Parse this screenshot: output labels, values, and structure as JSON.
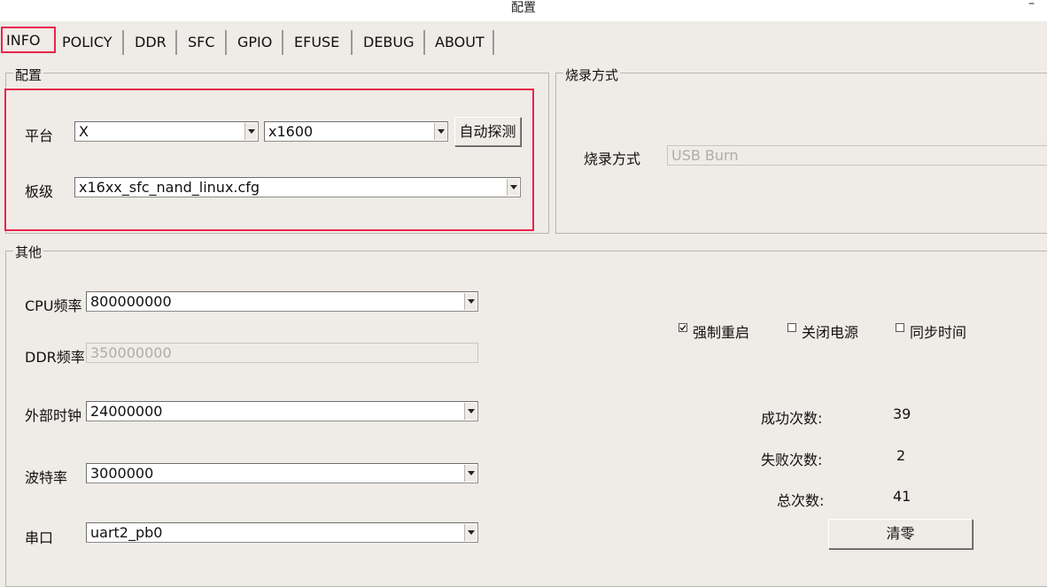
{
  "window": {
    "title": "配置",
    "minimize_glyph": "–"
  },
  "tabs": [
    "INFO",
    "POLICY",
    "DDR",
    "SFC",
    "GPIO",
    "EFUSE",
    "DEBUG",
    "ABOUT"
  ],
  "config_group": {
    "title": "配置",
    "platform_label": "平台",
    "platform_value": "X",
    "chip_value": "x1600",
    "auto_detect_label": "自动探测",
    "board_label": "板级",
    "board_value": "x16xx_sfc_nand_linux.cfg"
  },
  "burn_group": {
    "title": "烧录方式",
    "burn_mode_label": "烧录方式",
    "burn_mode_value": "USB Burn"
  },
  "other_group": {
    "title": "其他",
    "cpu_freq_label": "CPU频率",
    "cpu_freq_value": "800000000",
    "ddr_freq_label": "DDR频率",
    "ddr_freq_value": "350000000",
    "ext_clock_label": "外部时钟",
    "ext_clock_value": "24000000",
    "baud_label": "波特率",
    "baud_value": "3000000",
    "serial_label": "串口",
    "serial_value": "uart2_pb0",
    "force_reboot_label": "强制重启",
    "force_reboot_checked": true,
    "power_off_label": "关闭电源",
    "power_off_checked": false,
    "sync_time_label": "同步时间",
    "sync_time_checked": false,
    "success_label": "成功次数:",
    "success_count": "39",
    "fail_label": "失败次数:",
    "fail_count": "2",
    "total_label": "总次数:",
    "total_count": "41",
    "clear_label": "清零"
  },
  "colors": {
    "highlight": "#e8264a",
    "background": "#efebe7"
  }
}
